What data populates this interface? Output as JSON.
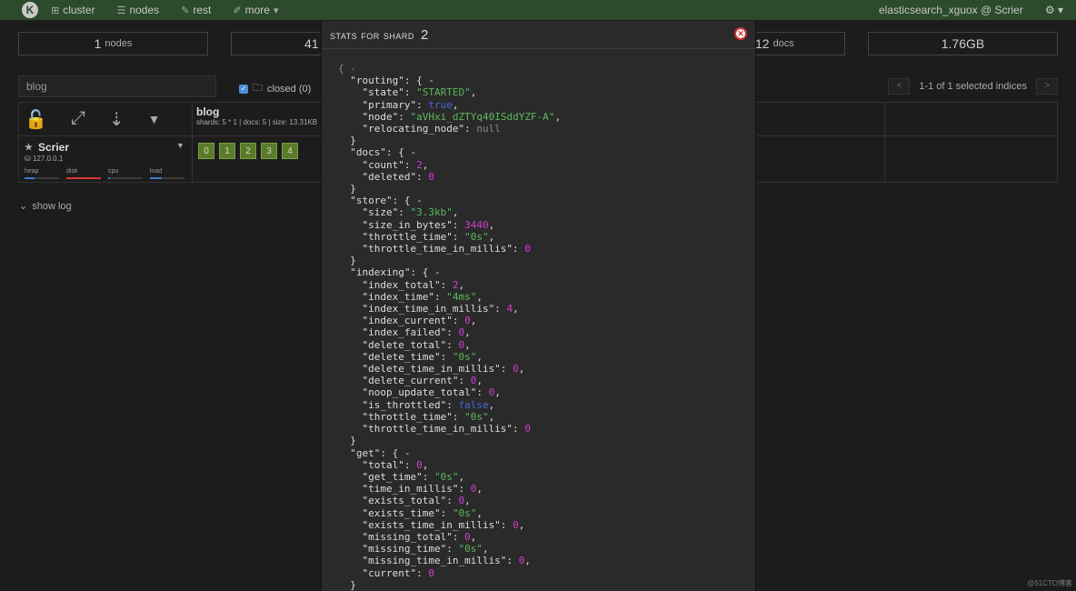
{
  "nav": {
    "logo": "K",
    "items": [
      {
        "label": "cluster",
        "icon": "sitemap-icon"
      },
      {
        "label": "nodes",
        "icon": "list-icon"
      },
      {
        "label": "rest",
        "icon": "edit-icon"
      },
      {
        "label": "more",
        "icon": "wrench-icon"
      }
    ],
    "user": "elasticsearch_xguox @ Scrier",
    "settings_icon": "gear-icon"
  },
  "stats": {
    "nodes_value": "1",
    "nodes_label": "nodes",
    "shards_value": "41",
    "docs_value": "12",
    "docs_label": "docs",
    "size_value": "1.76GB"
  },
  "filter": {
    "placeholder": "blog",
    "closed_label": "closed (0)",
    "pager_text": "1-1 of 1 selected indices",
    "prev": "<",
    "next": ">"
  },
  "node": {
    "name": "Scrier",
    "ip": "127.0.0.1",
    "metrics": [
      {
        "label": "heap",
        "level": 0.3,
        "color": "#3a7fd0"
      },
      {
        "label": "disk",
        "level": 1.0,
        "color": "#d33"
      },
      {
        "label": "cpu",
        "level": 0.05,
        "color": "#3a7fd0"
      },
      {
        "label": "load",
        "level": 0.35,
        "color": "#3a7fd0"
      }
    ]
  },
  "index": {
    "name": "blog",
    "info": "shards: 5 * 1 | docs: 5 | size: 13.31KB",
    "shards": [
      "0",
      "1",
      "2",
      "3",
      "4"
    ]
  },
  "show_log": "show log",
  "modal": {
    "title": "stats for shard",
    "shard": "2",
    "lines": [
      [
        [
          "nl",
          "{ -"
        ]
      ],
      [
        [
          "k",
          "  \"routing\": { -"
        ]
      ],
      [
        [
          "k",
          "    \"state\": "
        ],
        [
          "s",
          "\"STARTED\""
        ],
        [
          "k",
          ","
        ]
      ],
      [
        [
          "k",
          "    \"primary\": "
        ],
        [
          "b",
          "true"
        ],
        [
          "k",
          ","
        ]
      ],
      [
        [
          "k",
          "    \"node\": "
        ],
        [
          "s",
          "\"aVHxi_dZTYq40ISddYZF-A\""
        ],
        [
          "k",
          ","
        ]
      ],
      [
        [
          "k",
          "    \"relocating_node\": "
        ],
        [
          "nl",
          "null"
        ]
      ],
      [
        [
          "k",
          "  }"
        ]
      ],
      [
        [
          "k",
          "  \"docs\": { -"
        ]
      ],
      [
        [
          "k",
          "    \"count\": "
        ],
        [
          "n",
          "2"
        ],
        [
          "k",
          ","
        ]
      ],
      [
        [
          "k",
          "    \"deleted\": "
        ],
        [
          "n",
          "0"
        ]
      ],
      [
        [
          "k",
          "  }"
        ]
      ],
      [
        [
          "k",
          "  \"store\": { -"
        ]
      ],
      [
        [
          "k",
          "    \"size\": "
        ],
        [
          "s",
          "\"3.3kb\""
        ],
        [
          "k",
          ","
        ]
      ],
      [
        [
          "k",
          "    \"size_in_bytes\": "
        ],
        [
          "n",
          "3440"
        ],
        [
          "k",
          ","
        ]
      ],
      [
        [
          "k",
          "    \"throttle_time\": "
        ],
        [
          "s",
          "\"0s\""
        ],
        [
          "k",
          ","
        ]
      ],
      [
        [
          "k",
          "    \"throttle_time_in_millis\": "
        ],
        [
          "n",
          "0"
        ]
      ],
      [
        [
          "k",
          "  }"
        ]
      ],
      [
        [
          "k",
          "  \"indexing\": { -"
        ]
      ],
      [
        [
          "k",
          "    \"index_total\": "
        ],
        [
          "n",
          "2"
        ],
        [
          "k",
          ","
        ]
      ],
      [
        [
          "k",
          "    \"index_time\": "
        ],
        [
          "s",
          "\"4ms\""
        ],
        [
          "k",
          ","
        ]
      ],
      [
        [
          "k",
          "    \"index_time_in_millis\": "
        ],
        [
          "n",
          "4"
        ],
        [
          "k",
          ","
        ]
      ],
      [
        [
          "k",
          "    \"index_current\": "
        ],
        [
          "n",
          "0"
        ],
        [
          "k",
          ","
        ]
      ],
      [
        [
          "k",
          "    \"index_failed\": "
        ],
        [
          "n",
          "0"
        ],
        [
          "k",
          ","
        ]
      ],
      [
        [
          "k",
          "    \"delete_total\": "
        ],
        [
          "n",
          "0"
        ],
        [
          "k",
          ","
        ]
      ],
      [
        [
          "k",
          "    \"delete_time\": "
        ],
        [
          "s",
          "\"0s\""
        ],
        [
          "k",
          ","
        ]
      ],
      [
        [
          "k",
          "    \"delete_time_in_millis\": "
        ],
        [
          "n",
          "0"
        ],
        [
          "k",
          ","
        ]
      ],
      [
        [
          "k",
          "    \"delete_current\": "
        ],
        [
          "n",
          "0"
        ],
        [
          "k",
          ","
        ]
      ],
      [
        [
          "k",
          "    \"noop_update_total\": "
        ],
        [
          "n",
          "0"
        ],
        [
          "k",
          ","
        ]
      ],
      [
        [
          "k",
          "    \"is_throttled\": "
        ],
        [
          "b",
          "false"
        ],
        [
          "k",
          ","
        ]
      ],
      [
        [
          "k",
          "    \"throttle_time\": "
        ],
        [
          "s",
          "\"0s\""
        ],
        [
          "k",
          ","
        ]
      ],
      [
        [
          "k",
          "    \"throttle_time_in_millis\": "
        ],
        [
          "n",
          "0"
        ]
      ],
      [
        [
          "k",
          "  }"
        ]
      ],
      [
        [
          "k",
          "  \"get\": { -"
        ]
      ],
      [
        [
          "k",
          "    \"total\": "
        ],
        [
          "n",
          "0"
        ],
        [
          "k",
          ","
        ]
      ],
      [
        [
          "k",
          "    \"get_time\": "
        ],
        [
          "s",
          "\"0s\""
        ],
        [
          "k",
          ","
        ]
      ],
      [
        [
          "k",
          "    \"time_in_millis\": "
        ],
        [
          "n",
          "0"
        ],
        [
          "k",
          ","
        ]
      ],
      [
        [
          "k",
          "    \"exists_total\": "
        ],
        [
          "n",
          "0"
        ],
        [
          "k",
          ","
        ]
      ],
      [
        [
          "k",
          "    \"exists_time\": "
        ],
        [
          "s",
          "\"0s\""
        ],
        [
          "k",
          ","
        ]
      ],
      [
        [
          "k",
          "    \"exists_time_in_millis\": "
        ],
        [
          "n",
          "0"
        ],
        [
          "k",
          ","
        ]
      ],
      [
        [
          "k",
          "    \"missing_total\": "
        ],
        [
          "n",
          "0"
        ],
        [
          "k",
          ","
        ]
      ],
      [
        [
          "k",
          "    \"missing_time\": "
        ],
        [
          "s",
          "\"0s\""
        ],
        [
          "k",
          ","
        ]
      ],
      [
        [
          "k",
          "    \"missing_time_in_millis\": "
        ],
        [
          "n",
          "0"
        ],
        [
          "k",
          ","
        ]
      ],
      [
        [
          "k",
          "    \"current\": "
        ],
        [
          "n",
          "0"
        ]
      ],
      [
        [
          "k",
          "  }"
        ]
      ]
    ]
  },
  "watermark": "@51CTO博客"
}
